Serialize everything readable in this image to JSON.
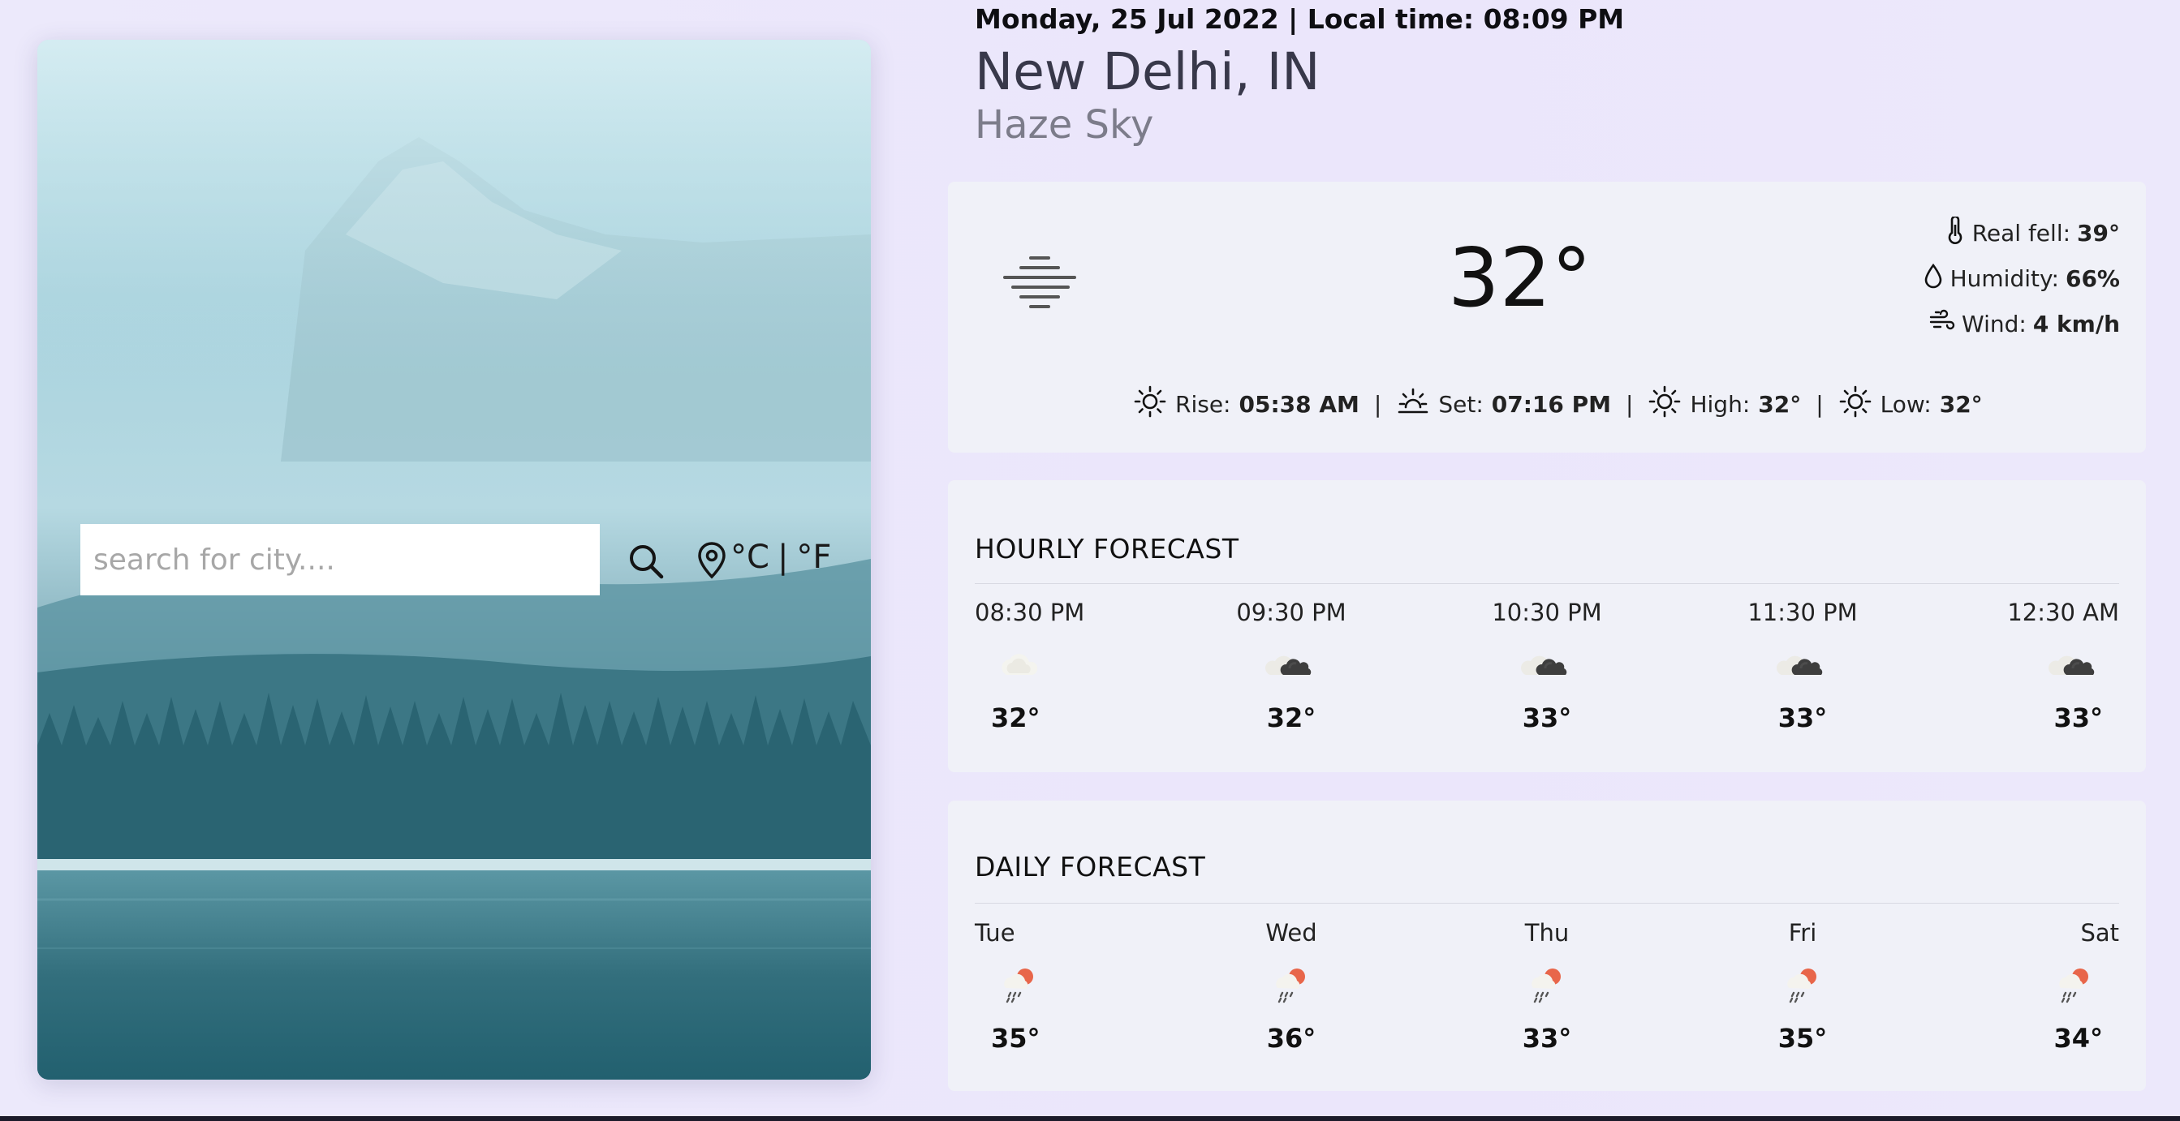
{
  "search": {
    "placeholder": "search for city...."
  },
  "units": {
    "celsius": "°C",
    "divider": "|",
    "fahrenheit": "°F"
  },
  "header": {
    "date_time": "Monday, 25 Jul 2022 | Local time: 08:09 PM",
    "city": "New Delhi, IN",
    "condition": "Haze Sky"
  },
  "current": {
    "temperature": "32°",
    "real_feel": {
      "label": "Real fell:",
      "value": "39°"
    },
    "humidity": {
      "label": "Humidity:",
      "value": "66%"
    },
    "wind": {
      "label": "Wind:",
      "value": "4 km/h"
    },
    "sun": [
      {
        "label": "Rise:",
        "value": "05:38 AM",
        "icon": "sunrise-icon"
      },
      {
        "label": "Set:",
        "value": "07:16 PM",
        "icon": "sunset-icon"
      },
      {
        "label": "High:",
        "value": "32°",
        "icon": "sun-icon"
      },
      {
        "label": "Low:",
        "value": "32°",
        "icon": "sun-icon"
      }
    ],
    "separator": "|"
  },
  "hourly": {
    "title": "HOURLY FORECAST",
    "items": [
      {
        "label": "08:30 PM",
        "temp": "32°",
        "icon": "haze-cloud-icon"
      },
      {
        "label": "09:30 PM",
        "temp": "32°",
        "icon": "dark-cloud-icon"
      },
      {
        "label": "10:30 PM",
        "temp": "33°",
        "icon": "dark-cloud-icon"
      },
      {
        "label": "11:30 PM",
        "temp": "33°",
        "icon": "dark-cloud-icon"
      },
      {
        "label": "12:30 AM",
        "temp": "33°",
        "icon": "dark-cloud-icon"
      }
    ]
  },
  "daily": {
    "title": "DAILY FORECAST",
    "items": [
      {
        "label": "Tue",
        "temp": "35°",
        "icon": "sun-rain-icon"
      },
      {
        "label": "Wed",
        "temp": "36°",
        "icon": "sun-rain-icon"
      },
      {
        "label": "Thu",
        "temp": "33°",
        "icon": "sun-rain-icon"
      },
      {
        "label": "Fri",
        "temp": "35°",
        "icon": "sun-rain-icon"
      },
      {
        "label": "Sat",
        "temp": "34°",
        "icon": "sun-rain-icon"
      }
    ]
  },
  "colors": {
    "accent_sun": "#e8664a",
    "card_bg": "#f0f1f8",
    "page_bg": "#ebe7fb"
  }
}
